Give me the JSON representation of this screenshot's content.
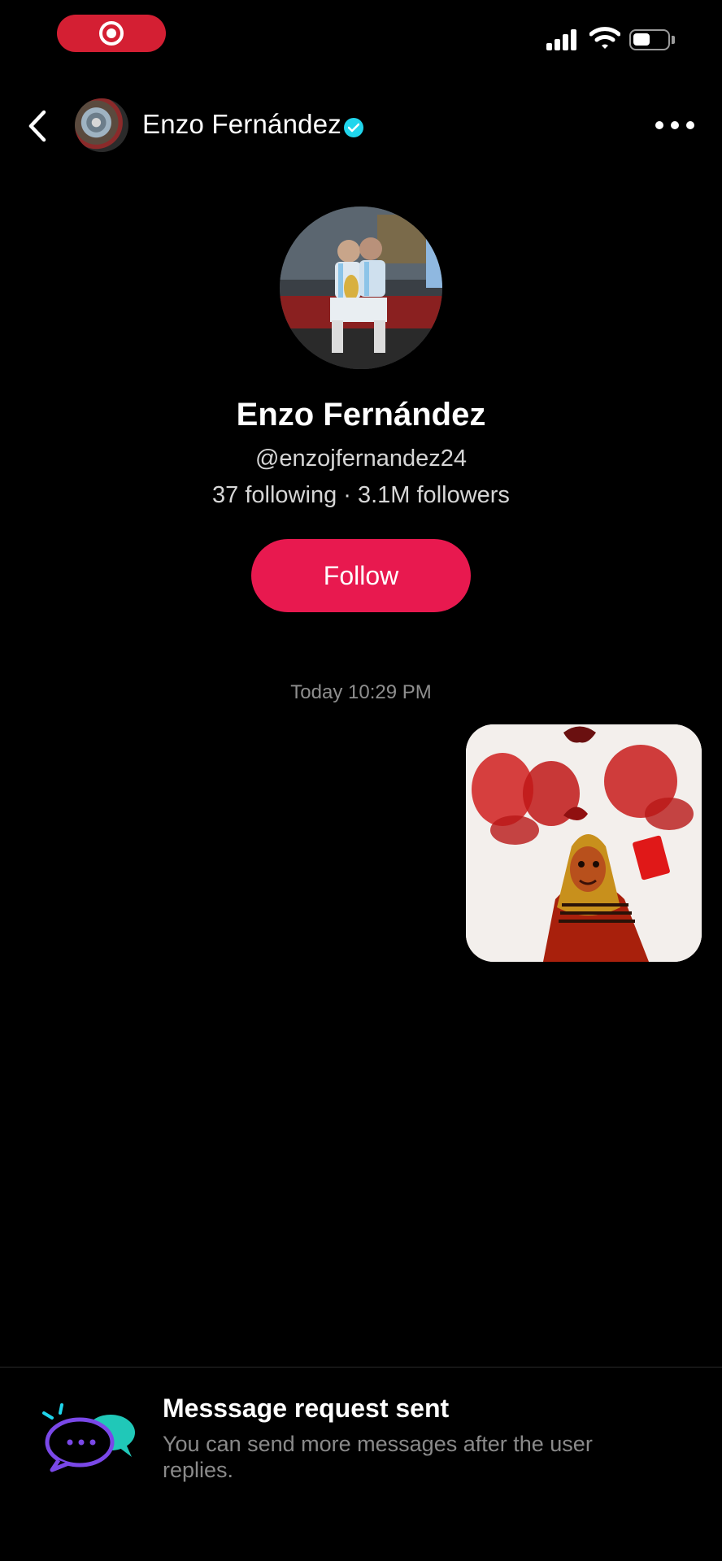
{
  "status_bar": {
    "recording_indicator": "screen-recording-icon",
    "signal": "signal-icon",
    "wifi": "wifi-icon",
    "battery": "battery-icon"
  },
  "header": {
    "back_icon": "chevron-left-icon",
    "name": "Enzo Fernández",
    "verified": true,
    "more_icon": "more-horizontal-icon"
  },
  "profile": {
    "name": "Enzo Fernández",
    "handle": "@enzojfernandez24",
    "stats": "37 following · 3.1M followers",
    "follow_label": "Follow"
  },
  "conversation": {
    "timestamp": "Today 10:29 PM",
    "messages": [
      {
        "type": "image",
        "sender": "me"
      }
    ]
  },
  "banner": {
    "icon": "chat-bubbles-icon",
    "title": "Messsage request sent",
    "subtitle": "You can send more messages after the user replies."
  },
  "colors": {
    "background": "#000000",
    "follow_button": "#e8194f",
    "recording": "#d41f33",
    "verified": "#20d5ec",
    "secondary_text": "#8a8a8a"
  }
}
